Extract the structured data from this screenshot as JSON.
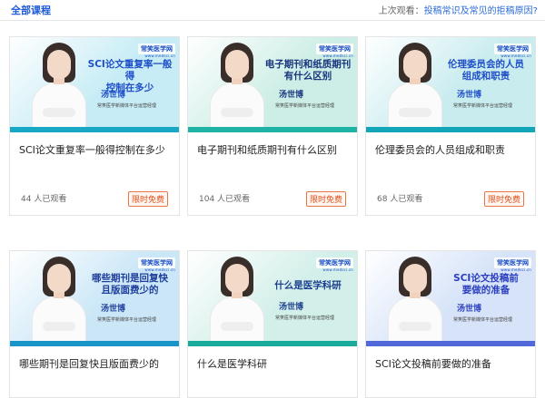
{
  "header": {
    "section_title": "全部课程",
    "recent_label": "上次观看：",
    "recent_course": "投稿常识及常见的拒稿原因?"
  },
  "thumbnail": {
    "brand": "常笑医学网",
    "brand_sub": "www.medsci.cn",
    "lecturer": "汤世博",
    "lecturer_role": "常笑医学新媒体平台运营经理"
  },
  "courses": [
    {
      "banner_line1": "SCI论文重复率一般得",
      "banner_line2": "控制在多少",
      "title": "SCI论文重复率一般得控制在多少",
      "views": "44 人已观看",
      "tag": "限时免费",
      "colors": {
        "bg": "#c7ecf5",
        "stripe": "#18a7c4",
        "banner": "#1f4fc8"
      }
    },
    {
      "banner_line1": "电子期刊和纸质期刊",
      "banner_line2": "有什么区别",
      "title": "电子期刊和纸质期刊有什么区别",
      "views": "104 人已观看",
      "tag": "限时免费",
      "colors": {
        "bg": "#cdeee6",
        "stripe": "#1eb3a4",
        "banner": "#18357d"
      }
    },
    {
      "banner_line1": "伦理委员会的人员",
      "banner_line2": "组成和职责",
      "title": "伦理委员会的人员组成和职责",
      "views": "68 人已观看",
      "tag": "限时免费",
      "colors": {
        "bg": "#c9ecef",
        "stripe": "#12a6b8",
        "banner": "#1f4fc8"
      }
    },
    {
      "banner_line1": "哪些期刊是回复快",
      "banner_line2": "且版面费少的",
      "title": "哪些期刊是回复快且版面费少的",
      "views": "",
      "tag": "",
      "colors": {
        "bg": "#cbe7f7",
        "stripe": "#1994c9",
        "banner": "#1f3f9c"
      }
    },
    {
      "banner_line1": "什么是医学科研",
      "banner_line2": "",
      "title": "什么是医学科研",
      "views": "",
      "tag": "",
      "colors": {
        "bg": "#d3efe9",
        "stripe": "#18aa9a",
        "banner": "#1c3f8f"
      }
    },
    {
      "banner_line1": "SCI论文投稿前",
      "banner_line2": "要做的准备",
      "title": "SCI论文投稿前要做的准备",
      "views": "",
      "tag": "",
      "colors": {
        "bg": "#d6e3f8",
        "stripe": "#5068d8",
        "banner": "#2b3fbf"
      }
    }
  ]
}
